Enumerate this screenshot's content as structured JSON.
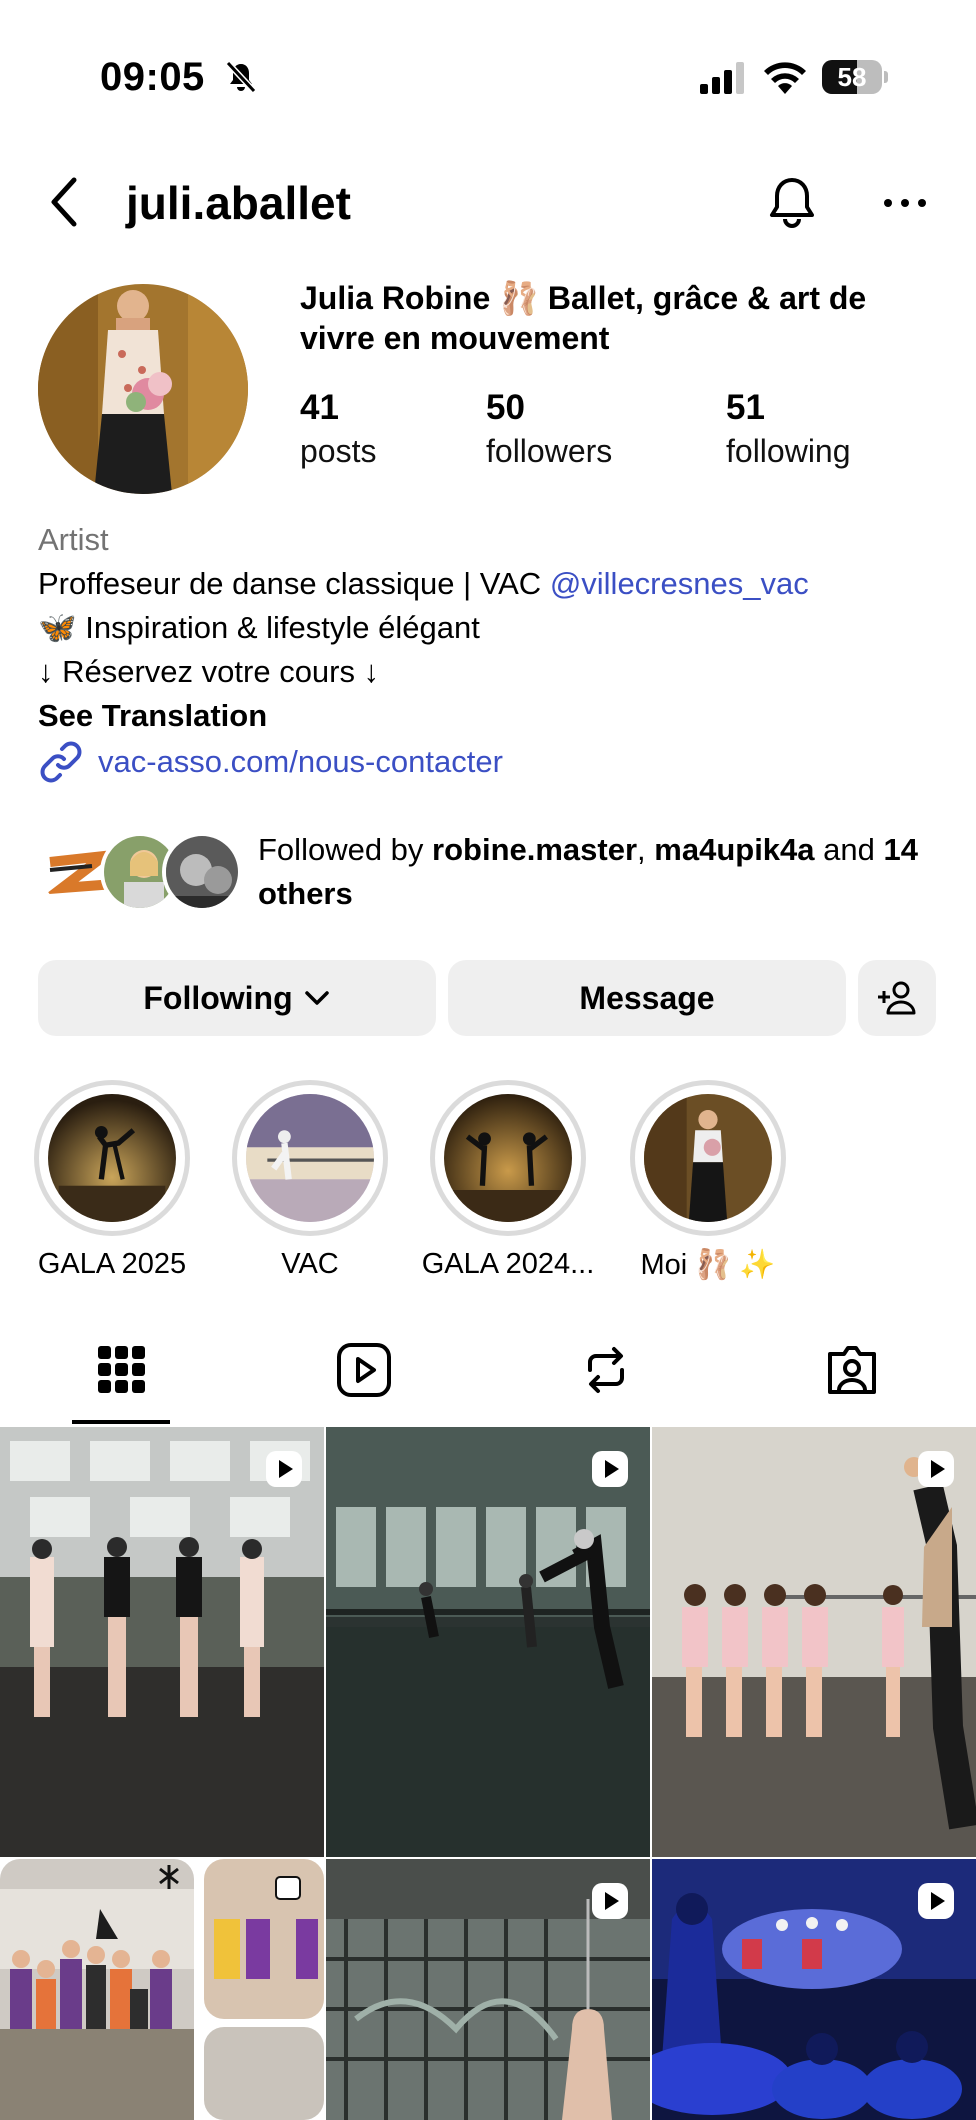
{
  "status_bar": {
    "time": "09:05",
    "battery_percent": "58"
  },
  "header": {
    "username": "juli.aballet"
  },
  "profile": {
    "display_name": "Julia Robine 🩰 Ballet, grâce & art de vivre en mouvement",
    "stats": {
      "posts_count": "41",
      "posts_label": "posts",
      "followers_count": "50",
      "followers_label": "followers",
      "following_count": "51",
      "following_label": "following"
    },
    "bio": {
      "category": "Artist",
      "line1_text": "Proffeseur de danse classique | VAC ",
      "line1_mention": "@villecresnes_vac",
      "line2": "🦋 Inspiration & lifestyle élégant",
      "line3": "↓ Réservez votre cours ↓",
      "see_translation": "See Translation",
      "link": "vac-asso.com/nous-contacter"
    },
    "followed_by": {
      "prefix": "Followed by ",
      "user1": "robine.master",
      "separator": ", ",
      "user2": "ma4upik4a",
      "and": " and ",
      "others": "14 others"
    }
  },
  "actions": {
    "following_label": "Following",
    "message_label": "Message"
  },
  "highlights": [
    {
      "label": "GALA 2025"
    },
    {
      "label": "VAC"
    },
    {
      "label": "GALA 2024..."
    },
    {
      "label": "Moi 🩰 ✨"
    }
  ],
  "tabs": [
    "posts-grid",
    "reels",
    "reposts",
    "tagged"
  ],
  "icons": {
    "back": "chevron-left-icon",
    "notifications": "bell-icon",
    "more": "more-horizontal-icon",
    "link": "link-icon",
    "add_person": "add-person-icon",
    "reel": "reel-play-icon"
  },
  "colors": {
    "link_blue": "#3b4fc4",
    "button_bg": "#efefef",
    "muted": "#737373"
  }
}
